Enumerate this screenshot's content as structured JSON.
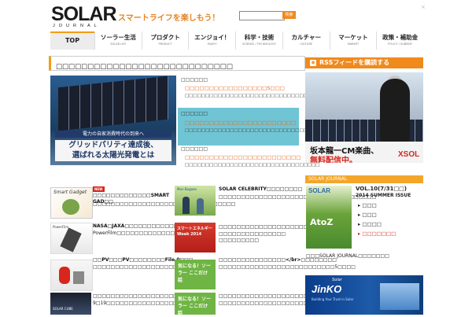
{
  "header": {
    "logo_main": "SOLAR",
    "logo_sub": "JOURNAL",
    "tagline": "スマートライフを楽しもう！",
    "search_placeholder": "",
    "search_button": "検索",
    "close": "×"
  },
  "nav": {
    "top": "TOP",
    "items": [
      {
        "jp": "ソーラー生活",
        "en": "SOLAR LIFE"
      },
      {
        "jp": "プロダクト",
        "en": "PRODUCT"
      },
      {
        "jp": "エンジョイ！",
        "en": "ENJOY!"
      },
      {
        "jp": "科学・技術",
        "en": "SCIENCE / TECHNOLOGY"
      },
      {
        "jp": "カルチャー",
        "en": "CULTURE"
      },
      {
        "jp": "マーケット",
        "en": "MARKET"
      },
      {
        "jp": "政策・補助金",
        "en": "POLICY / SUBSIDY"
      }
    ]
  },
  "main": {
    "section_title": "□□□□□□□□□□□□□□□□□□□□□□□□□□□□",
    "feature": {
      "caption_small": "電力の自家消費時代の到来へ",
      "caption_large_1": "グリッドパリティ達成後、",
      "caption_large_2": "選ばれる太陽光発電とは",
      "items": [
        {
          "cat": "□□□□□□",
          "head": "□□□□□□□□□□□□□□□□□S□□□",
          "desc": "□□□□□□□□□□□□□□□□□□□□□□□□□□□□□□□□□"
        },
        {
          "cat": "□□□□□□",
          "head": "□□□□□□□□□□□□□□□□□□□□□□□",
          "desc": "□□□□□□□□□□□□□□□□□□□□□□□□□□□□□□□□□"
        },
        {
          "cat": "□□□□□□",
          "head": "□□□□□□□□□□□□□□□□□□□□□□□□",
          "desc": "□□□□□□□□□□□□□□□□□□□□□□□□□□□□□□□□□"
        }
      ]
    },
    "grid": [
      {
        "title": "□□□□□□□□□□□□□SMART GAD□□",
        "desc": "□□□□□□□□□□□□□□□□□□□□□□□□□□□□□□□□",
        "img": "Smart Gadget",
        "new": "NEW"
      },
      {
        "title": "SOLAR CELEBRITY□□□□□□□□",
        "desc": "□□□□□□□□□□□□□□□□□□□□□□□□□□□12□□□□□□□",
        "img": "Mori Bogaan"
      },
      {
        "title": "NASA□JAXA□□□□□□□□□□□□□□",
        "desc": "PowerFilm□□□□□□□□□□□□□□□□□",
        "img": "PowerFilm"
      },
      {
        "title": "□□□□□□□□□□□□□□□□□□□□",
        "desc": "□□□□□□□□□□□□□□□ □□□□□□□□□",
        "img": "スマートエネルギー Week 2014"
      },
      {
        "title": "□□PV□□□PV□□□□□□□□File.0□□□",
        "desc": "□□□□□□□□□□□□□□□□□□□□□□□□□□□",
        "img": ""
      },
      {
        "title": "□□□□□□□□□□□□□□□</br>□□□□□□□□",
        "desc": "□□□□□□□□□□□□□□□□□□□□□□□□□□5□□□□",
        "img": "気になる！ソーラー ここだけ話"
      },
      {
        "title": "□□□□□□□□□□□□□□□□□□□□",
        "desc": "9□19□□□□□□□□□□□□□□□□□□□□□□□□",
        "img": "SOLAR CUBE"
      },
      {
        "title": "□□□□□□□□□□□□□□□□□□□□□□",
        "desc": "□□□□□□□□□□□□□□□□□□□□□□□□□□□□",
        "img": "気になる！ソーラー ここだけ話"
      }
    ]
  },
  "sidebar": {
    "rss": "RSSフィードを購読する",
    "ad": {
      "line1": "坂本龍一CM楽曲、",
      "line2": "無料配信中。",
      "brand": "XSOL"
    },
    "journal_bar": "SOLAR JOURNAL",
    "mag": {
      "title": "SOLAR",
      "big": "AtoZ",
      "vol": "VOL.10(7/31□□)",
      "season": "2014 SUMMER ISSUE",
      "bullets": [
        "□□□",
        "□□□",
        "□□□□",
        "□□□□□□□"
      ]
    },
    "ext": "□□□SOLAR JOURNAL□□□□□□□",
    "jinko": {
      "brand": "JinKO",
      "solar": "Solar",
      "sub": "Building Your Trust in Solar"
    }
  },
  "colors": {
    "accent": "#f08a1c",
    "red": "#d7261e",
    "navy": "#1e3867"
  }
}
